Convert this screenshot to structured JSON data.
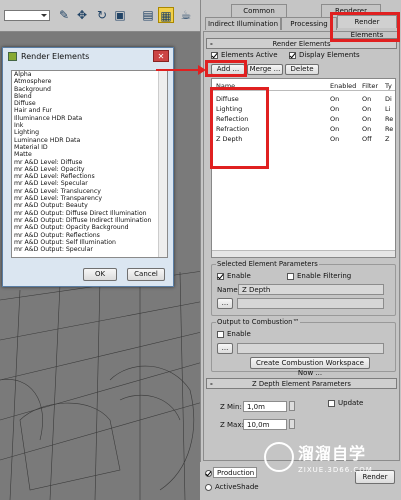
{
  "render_elements_dialog": {
    "title": "Render Elements",
    "items": [
      "Alpha",
      "Atmosphere",
      "Background",
      "Blend",
      "Diffuse",
      "Hair and Fur",
      "Illuminance HDR Data",
      "Ink",
      "Lighting",
      "Luminance HDR Data",
      "Material ID",
      "Matte",
      "mr A&D Level: Diffuse",
      "mr A&D Level: Opacity",
      "mr A&D Level: Reflections",
      "mr A&D Level: Specular",
      "mr A&D Level: Translucency",
      "mr A&D Level: Transparency",
      "mr A&D Output: Beauty",
      "mr A&D Output: Diffuse Direct Illumination",
      "mr A&D Output: Diffuse Indirect Illumination",
      "mr A&D Output: Opacity Background",
      "mr A&D Output: Reflections",
      "mr A&D Output: Self Illumination",
      "mr A&D Output: Specular"
    ],
    "ok_label": "OK",
    "cancel_label": "Cancel"
  },
  "panel": {
    "tabs_row1": [
      "Common",
      "Renderer"
    ],
    "tabs_row2": [
      "Indirect Illumination",
      "Processing",
      "Render Elements"
    ],
    "render_elements_section": "Render Elements",
    "elements_active_label": "Elements Active",
    "display_elements_label": "Display Elements",
    "add_label": "Add ...",
    "merge_label": "Merge ...",
    "delete_label": "Delete",
    "table": {
      "columns": [
        "Name",
        "Enabled",
        "Filter",
        "Ty"
      ],
      "rows": [
        {
          "name": "Diffuse",
          "enabled": "On",
          "filter": "On",
          "type": "Di"
        },
        {
          "name": "Lighting",
          "enabled": "On",
          "filter": "On",
          "type": "Li"
        },
        {
          "name": "Reflection",
          "enabled": "On",
          "filter": "On",
          "type": "Re"
        },
        {
          "name": "Refraction",
          "enabled": "On",
          "filter": "On",
          "type": "Re"
        },
        {
          "name": "Z Depth",
          "enabled": "On",
          "filter": "Off",
          "type": "Z"
        }
      ]
    },
    "selected_params": {
      "title": "Selected Element Parameters",
      "enable_label": "Enable",
      "enable_filtering_label": "Enable Filtering",
      "name_label": "Name:",
      "name_value": "Z Depth",
      "browse_label": "..."
    },
    "combustion": {
      "title": "Output to Combustion™",
      "enable_label": "Enable",
      "browse_label": "...",
      "create_label": "Create Combustion Workspace Now ..."
    },
    "zdepth": {
      "title": "Z Depth Element Parameters",
      "zmin_label": "Z Min:",
      "zmin_value": "1,0m",
      "zmax_label": "Z Max:",
      "zmax_value": "10,0m",
      "update_label": "Update"
    },
    "bottom": {
      "production_label": "Production",
      "activeshade_label": "ActiveShade",
      "render_label": "Render"
    }
  },
  "watermark": {
    "title": "溜溜自学",
    "url": "ZIXUE.3D66.COM"
  }
}
